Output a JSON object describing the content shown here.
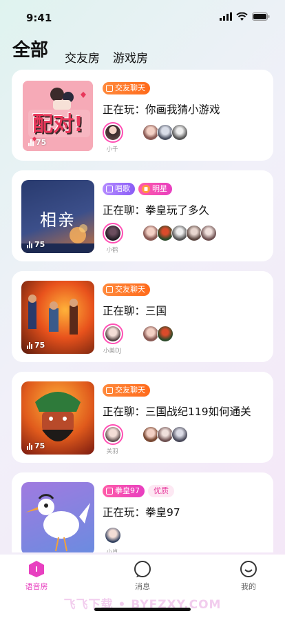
{
  "status": {
    "time": "9:41"
  },
  "tabs": {
    "main": "全部",
    "t1": "交友房",
    "t2": "游戏房"
  },
  "rooms": [
    {
      "badges": [
        "交友聊天"
      ],
      "topic": "正在玩：你画我猜小游戏",
      "host": "小千",
      "count": "75",
      "cover_text": "配对!"
    },
    {
      "badges": [
        "唱歌",
        "明星"
      ],
      "topic": "正在聊：拳皇玩了多久",
      "host": "小鹤",
      "count": "75",
      "cover_text": "相亲"
    },
    {
      "badges": [
        "交友聊天"
      ],
      "topic": "正在聊：三国",
      "host": "小美DJ",
      "count": "75"
    },
    {
      "badges": [
        "交友聊天"
      ],
      "topic": "正在聊：三国战纪119如何通关",
      "host": "关羽",
      "count": "75"
    },
    {
      "badges": [
        "拳皇97",
        "优质"
      ],
      "topic": "正在玩：拳皇97",
      "host": "小肖"
    }
  ],
  "tabbar": {
    "voice": "语音房",
    "messages": "消息",
    "mine": "我的"
  },
  "watermark": "飞飞下载 • BYFZXY.COM",
  "colors": {
    "accent": "#e840c0",
    "orange_badge": "#ff7a2a",
    "purple_badge": "#9b6cff",
    "pink_badge": "#f04eb4"
  }
}
